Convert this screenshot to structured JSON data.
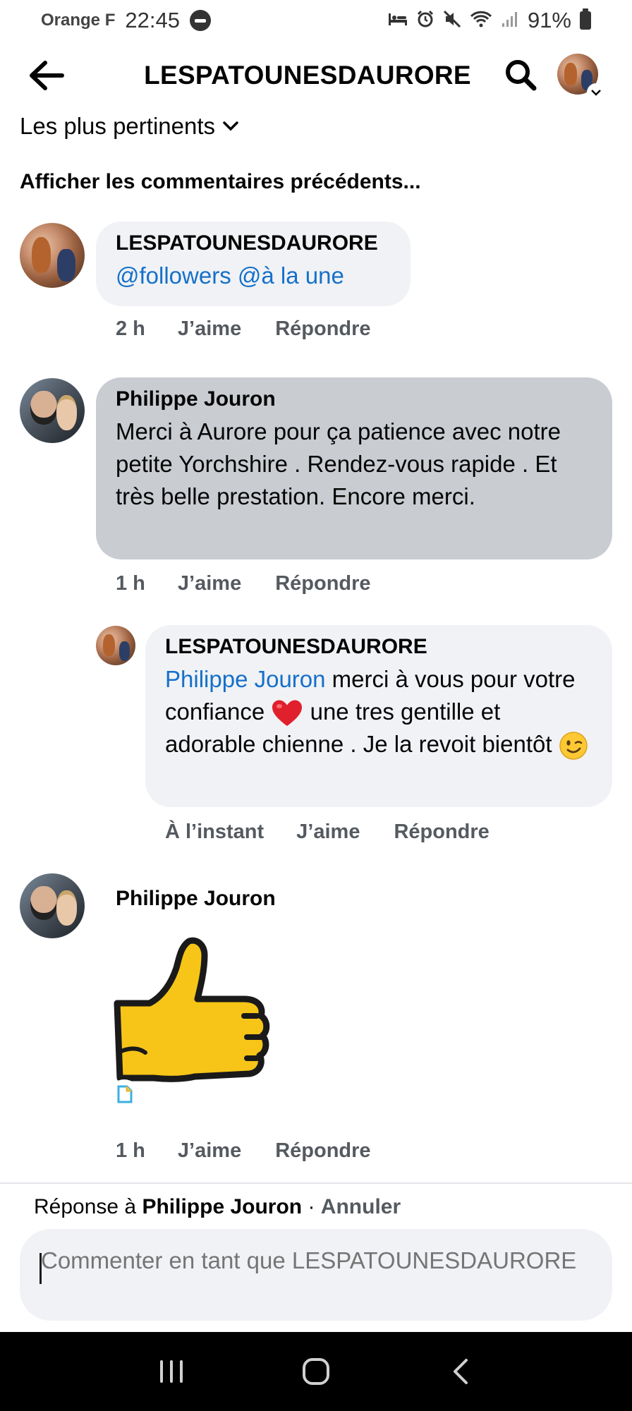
{
  "status_bar": {
    "carrier": "Orange F",
    "time": "22:45",
    "battery": "91%"
  },
  "header": {
    "title": "LESPATOUNESDAURORE"
  },
  "sort": {
    "label": "Les plus pertinents"
  },
  "previous_comments_link": "Afficher les commentaires précédents...",
  "comments": [
    {
      "author": "LESPATOUNESDAURORE",
      "text": "@followers @à la une",
      "time": "2 h",
      "like_label": "J’aime",
      "reply_label": "Répondre"
    },
    {
      "author": "Philippe Jouron",
      "text": "Merci à Aurore pour ça patience avec notre petite Yorchshire . Rendez-vous rapide . Et très belle prestation. Encore merci.",
      "time": "1 h",
      "like_label": "J’aime",
      "reply_label": "Répondre"
    },
    {
      "author": "LESPATOUNESDAURORE",
      "mention": "Philippe Jouron",
      "text_part1": " merci à vous pour votre confiance ",
      "text_part2": " une tres gentille et adorable chienne . Je la revoit bientôt ",
      "time": "À l’instant",
      "like_label": "J’aime",
      "reply_label": "Répondre"
    },
    {
      "author": "Philippe Jouron",
      "sticker": "thumbs-up",
      "time": "1 h",
      "like_label": "J’aime",
      "reply_label": "Répondre"
    }
  ],
  "reply_bar": {
    "prefix": "Réponse à ",
    "target": "Philippe Jouron",
    "separator": " · ",
    "cancel": "Annuler"
  },
  "composer": {
    "placeholder": "Commenter en tant que LESPATOUNESDAURORE"
  },
  "colors": {
    "mention": "#1670c9",
    "bubble": "#f0f2f5",
    "bubble_highlight": "#c9ccd1",
    "heart": "#e0202c"
  }
}
